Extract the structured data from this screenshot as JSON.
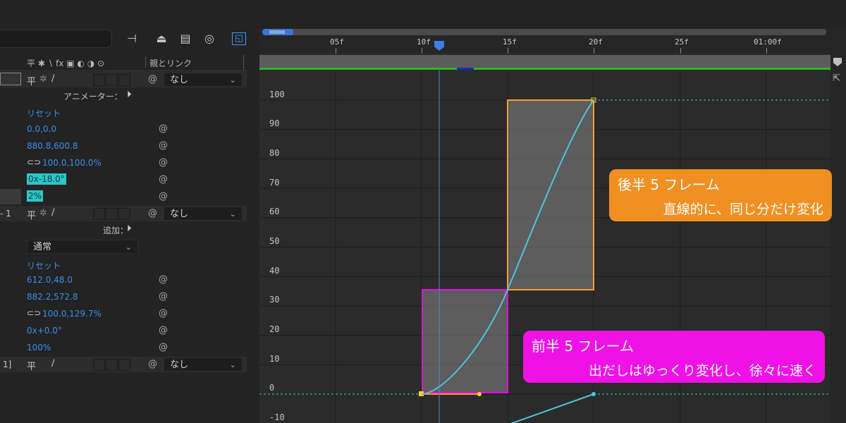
{
  "toolbar": {
    "icons": [
      "hierarchy-icon",
      "anchor-icon",
      "film-icon",
      "motion-blur-icon",
      "graph-editor-icon"
    ]
  },
  "columns": {
    "switches_header": "平 ✱ ∖ fx ▣ ◐ ◑ ⊙",
    "parent_header": "親とリンク"
  },
  "layers": {
    "layer1": {
      "parent": "なし"
    },
    "layer2": {
      "index": "- 1",
      "parent": "なし"
    },
    "layer3": {
      "index": "1]",
      "parent": "なし"
    }
  },
  "group1": {
    "animator_label": "アニメーター：",
    "reset": "リセット",
    "anchor": "0.0,0.0",
    "position": "880.8,600.8",
    "scale": "100.0,100.0%",
    "rotation": "0x-18.0°",
    "opacity": "2%"
  },
  "group2": {
    "add_label": "追加：",
    "blend_mode": "通常",
    "reset": "リセット",
    "anchor": "612.0,48.0",
    "position": "882.2,572.8",
    "scale": "100.0,129.7%",
    "rotation": "0x+0.0°",
    "opacity": "100%"
  },
  "ruler": {
    "labels": [
      "05f",
      "10f",
      "15f",
      "20f",
      "25f",
      "01:00f"
    ]
  },
  "graph_axis": {
    "labels": [
      "100",
      "90",
      "80",
      "70",
      "60",
      "50",
      "40",
      "30",
      "20",
      "10",
      "0",
      "-10"
    ]
  },
  "callouts": {
    "latter": {
      "title": "後半 5 フレーム",
      "body": "直線的に、同じ分だけ変化",
      "color": "#f08f22"
    },
    "former": {
      "title": "前半 5 フレーム",
      "body": "出だしはゆっくり変化し、徐々に速く",
      "color": "#ee12e6"
    }
  },
  "colors": {
    "accent_blue": "#3d9bff",
    "value_blue": "#3b8eea",
    "curve": "#4fc4d8",
    "highlight": "#28c8c8"
  }
}
